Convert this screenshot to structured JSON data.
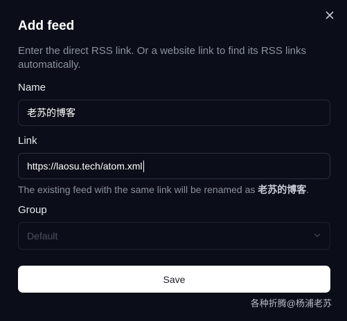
{
  "dialog": {
    "title": "Add feed",
    "description": "Enter the direct RSS link. Or a website link to find its RSS links automatically.",
    "close_icon": "close-icon"
  },
  "name_field": {
    "label": "Name",
    "value": "老苏的博客"
  },
  "link_field": {
    "label": "Link",
    "value": "https://laosu.tech/atom.xml",
    "hint_prefix": "The existing feed with the same link will be renamed as ",
    "hint_name": "老苏的博客",
    "hint_suffix": "."
  },
  "group_field": {
    "label": "Group",
    "placeholder": "Default",
    "chevron_icon": "chevron-down-icon"
  },
  "save_button": {
    "label": "Save"
  },
  "watermark": {
    "text": "各种折腾@杨浦老苏"
  },
  "colors": {
    "background": "#0b0e18",
    "button": "#ffffff",
    "muted_text": "#8b91a0"
  }
}
